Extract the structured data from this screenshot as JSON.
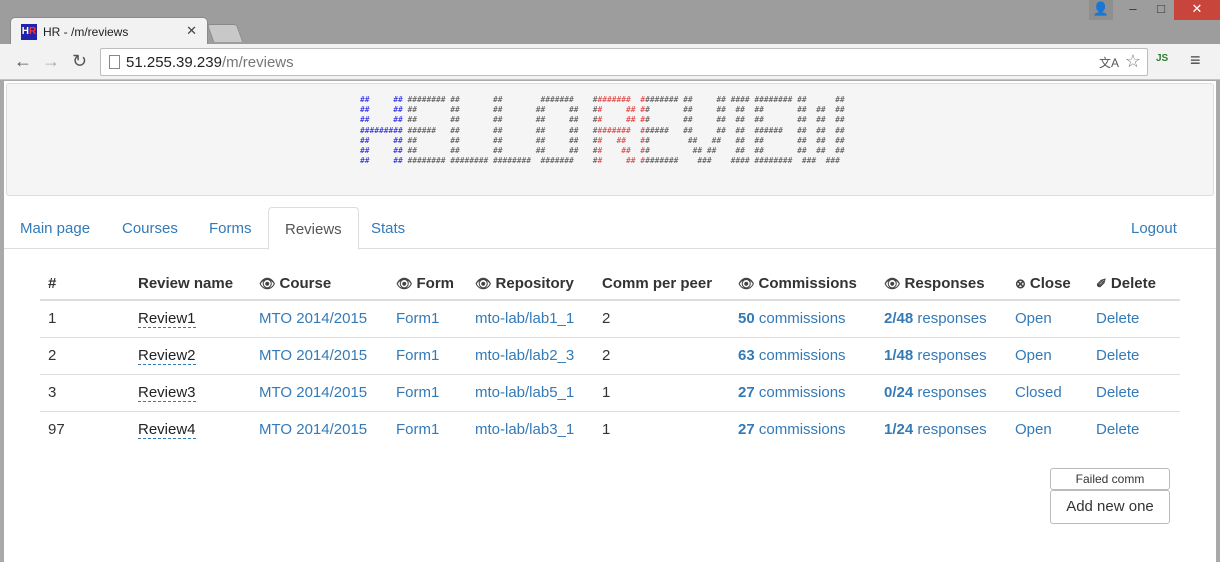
{
  "browser": {
    "tab_title": "HR - /m/reviews",
    "url_host": "51.255.39.239",
    "url_path": "/m/reviews",
    "window_buttons": {
      "user": "👤",
      "minimize": "–",
      "maximize": "□",
      "close": "✕"
    },
    "extension_label": "JS"
  },
  "banner": {
    "ascii_lines": [
      "##     ## ######## ##       ##        #######    ########  ######## ##     ## #### ######## ##      ##",
      "##     ## ##       ##       ##       ##     ##   ##     ## ##       ##     ##  ##  ##       ##  ##  ##",
      "##     ## ##       ##       ##       ##     ##   ##     ## ##       ##     ##  ##  ##       ##  ##  ##",
      "######### ######   ##       ##       ##     ##   ########  ######   ##     ##  ##  ######   ##  ##  ##",
      "##     ## ##       ##       ##       ##     ##   ##   ##   ##        ##   ##   ##  ##       ##  ##  ##",
      "##     ## ##       ##       ##       ##     ##   ##    ##  ##         ## ##    ##  ##       ##  ##  ##",
      "##     ## ######## ######## ########  #######    ##     ## ########    ###    #### ########  ###  ###"
    ]
  },
  "nav": {
    "tabs": [
      "Main page",
      "Courses",
      "Forms",
      "Reviews",
      "Stats"
    ],
    "active": "Reviews",
    "logout": "Logout"
  },
  "table": {
    "headers": [
      "#",
      "Review name",
      "Course",
      "Form",
      "Repository",
      "Comm per peer",
      "Commissions",
      "Responses",
      "Close",
      "Delete"
    ],
    "rows": [
      {
        "id": "1",
        "name": "Review1",
        "course": "MTO 2014/2015",
        "form": "Form1",
        "repo": "mto-lab/lab1_1",
        "comm_per_peer": "2",
        "commissions_count": "50",
        "commissions_label": "commissions",
        "responses_count": "2/48",
        "responses_label": "responses",
        "close": "Open",
        "delete": "Delete"
      },
      {
        "id": "2",
        "name": "Review2",
        "course": "MTO 2014/2015",
        "form": "Form1",
        "repo": "mto-lab/lab2_3",
        "comm_per_peer": "2",
        "commissions_count": "63",
        "commissions_label": "commissions",
        "responses_count": "1/48",
        "responses_label": "responses",
        "close": "Open",
        "delete": "Delete"
      },
      {
        "id": "3",
        "name": "Review3",
        "course": "MTO 2014/2015",
        "form": "Form1",
        "repo": "mto-lab/lab5_1",
        "comm_per_peer": "1",
        "commissions_count": "27",
        "commissions_label": "commissions",
        "responses_count": "0/24",
        "responses_label": "responses",
        "close": "Closed",
        "delete": "Delete"
      },
      {
        "id": "97",
        "name": "Review4",
        "course": "MTO 2014/2015",
        "form": "Form1",
        "repo": "mto-lab/lab3_1",
        "comm_per_peer": "1",
        "commissions_count": "27",
        "commissions_label": "commissions",
        "responses_count": "1/24",
        "responses_label": "responses",
        "close": "Open",
        "delete": "Delete"
      }
    ]
  },
  "actions": {
    "failed_comm": "Failed comm",
    "add_new": "Add new one"
  },
  "colors": {
    "link": "#337ab7",
    "ascii_blue": "#2323e6",
    "ascii_red": "#e23b3b",
    "window_close": "#c7453b"
  }
}
